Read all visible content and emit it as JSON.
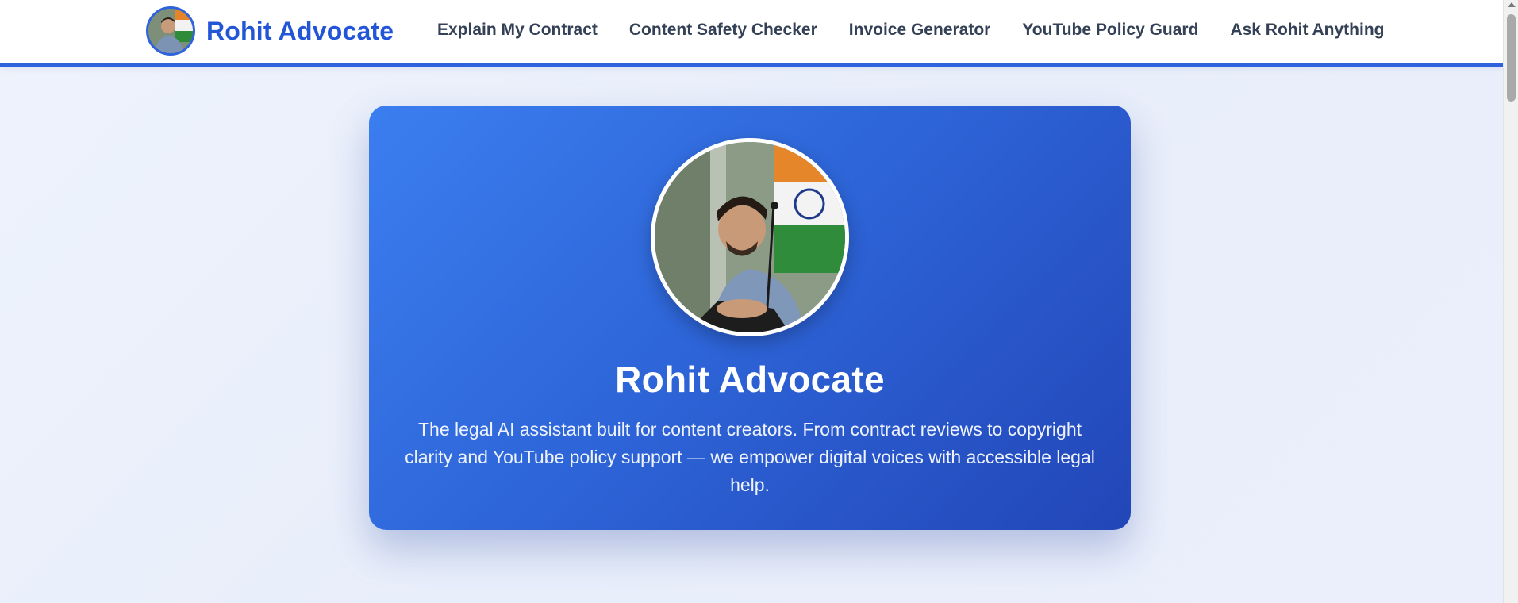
{
  "brand": {
    "name": "Rohit Advocate",
    "accent_color": "#2356d6"
  },
  "nav": {
    "items": [
      {
        "label": "Explain My Contract"
      },
      {
        "label": "Content Safety Checker"
      },
      {
        "label": "Invoice Generator"
      },
      {
        "label": "YouTube Policy Guard"
      },
      {
        "label": "Ask Rohit Anything"
      }
    ]
  },
  "hero": {
    "title": "Rohit Advocate",
    "description": "The legal AI assistant built for content creators. From contract reviews to copyright clarity and YouTube policy support — we empower digital voices with accessible legal help.",
    "gradient_start": "#3b7ef0",
    "gradient_end": "#2246b8",
    "photo_icon": "profile-photo"
  }
}
